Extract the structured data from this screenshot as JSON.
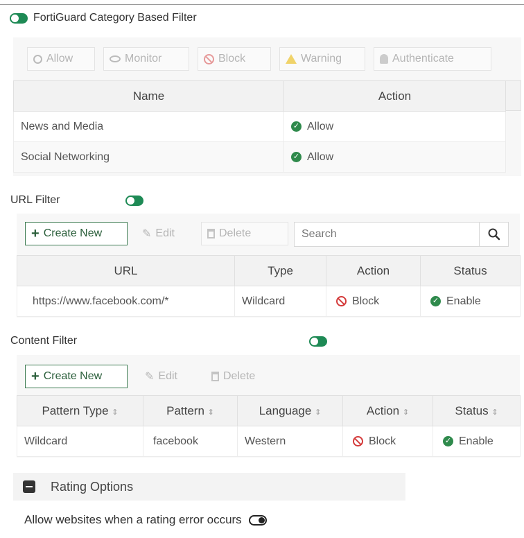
{
  "fortiguard": {
    "title": "FortiGuard Category Based Filter",
    "toggle_on": true,
    "actions": [
      "Allow",
      "Monitor",
      "Block",
      "Warning",
      "Authenticate"
    ],
    "columns": [
      "Name",
      "Action"
    ],
    "rows": [
      {
        "name": "News and Media",
        "action": "Allow"
      },
      {
        "name": "Social Networking",
        "action": "Allow"
      }
    ]
  },
  "url_filter": {
    "title": "URL Filter",
    "toggle_on": true,
    "create_label": "Create New",
    "edit_label": "Edit",
    "delete_label": "Delete",
    "search_placeholder": "Search",
    "columns": [
      "URL",
      "Type",
      "Action",
      "Status"
    ],
    "rows": [
      {
        "url": "https://www.facebook.com/*",
        "type": "Wildcard",
        "action": "Block",
        "status": "Enable"
      }
    ]
  },
  "content_filter": {
    "title": "Content Filter",
    "toggle_on": true,
    "create_label": "Create New",
    "edit_label": "Edit",
    "delete_label": "Delete",
    "columns": [
      "Pattern Type",
      "Pattern",
      "Language",
      "Action",
      "Status"
    ],
    "rows": [
      {
        "pattern_type": "Wildcard",
        "pattern": "facebook",
        "language": "Western",
        "action": "Block",
        "status": "Enable"
      }
    ]
  },
  "rating_options": {
    "title": "Rating Options",
    "allow_on_error_label": "Allow websites when a rating error occurs",
    "allow_on_error": false
  },
  "colors": {
    "accent_green": "#1e8a55",
    "block_red": "#d43b3b",
    "warning_yellow": "#f0c419"
  }
}
